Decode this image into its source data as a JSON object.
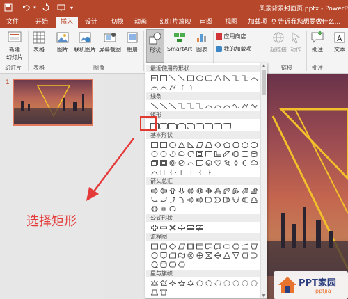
{
  "titlebar": {
    "document_title": "风景背景封面页.pptx - PowerPoint"
  },
  "tabs": [
    {
      "label": "文件"
    },
    {
      "label": "开始"
    },
    {
      "label": "插入"
    },
    {
      "label": "设计"
    },
    {
      "label": "切换"
    },
    {
      "label": "动画"
    },
    {
      "label": "幻灯片放映"
    },
    {
      "label": "审阅"
    },
    {
      "label": "视图"
    },
    {
      "label": "加载项"
    }
  ],
  "tell_me": "告诉我您想要做什么...",
  "ribbon": {
    "new_slide": "新建\n幻灯片",
    "table": "表格",
    "picture": "图片",
    "online_picture": "联机图片",
    "screenshot": "屏幕截图",
    "album": "相册",
    "shapes": "形状",
    "smartart": "SmartArt",
    "chart": "图表",
    "store": "应用商店",
    "my_addins": "我的加载项",
    "hyperlink": "超链接",
    "action": "动作",
    "comment": "批注",
    "text": "文本",
    "group_slides": "幻灯片",
    "group_tables": "表格",
    "group_images": "图像",
    "group_links": "链接",
    "group_comments": "批注"
  },
  "dropdown": {
    "categories": {
      "recent": "最近使用的形状",
      "lines": "线条",
      "rect": "矩形",
      "basic": "基本形状",
      "arrows": "箭头总汇",
      "equation": "公式形状",
      "flowchart": "流程图",
      "stars": "星与旗帜"
    }
  },
  "slides_pane": {
    "slide_number": "1"
  },
  "annotation": "选择矩形",
  "watermark": {
    "brand": "PPT家园",
    "site": "pptjia"
  },
  "colors": {
    "accent": "#b7472a",
    "highlight": "#e03a30",
    "annotation": "#e43a3a"
  }
}
